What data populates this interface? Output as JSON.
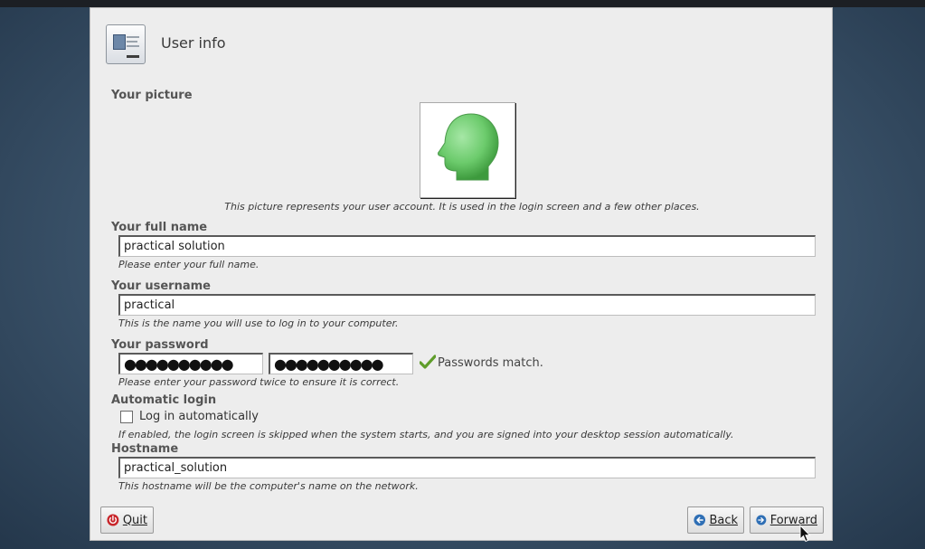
{
  "window": {
    "title": "User info",
    "icon": "user-card-icon"
  },
  "picture": {
    "label": "Your picture",
    "icon": "head-avatar-icon",
    "description": "This picture represents your user account. It is used in the login screen and a few other places."
  },
  "full_name": {
    "label": "Your full name",
    "value": "practical solution",
    "help": "Please enter your full name."
  },
  "username": {
    "label": "Your username",
    "value": "practical",
    "help": "This is the name you will use to log in to your computer."
  },
  "password": {
    "label": "Your password",
    "value_masked": "●●●●●●●●●●",
    "confirm_masked": "●●●●●●●●●●",
    "status": "Passwords match.",
    "status_icon": "checkmark-icon",
    "help": "Please enter your password twice to ensure it is correct."
  },
  "auto_login": {
    "label": "Automatic login",
    "checkbox_label": "Log in automatically",
    "checked": false,
    "help": "If enabled, the login screen is skipped when the system starts, and you are signed into your desktop session automatically."
  },
  "hostname": {
    "label": "Hostname",
    "value": "practical_solution",
    "help": "This hostname will be the computer's name on the network."
  },
  "buttons": {
    "quit": "Quit",
    "back": "Back",
    "forward": "Forward"
  },
  "colors": {
    "quit_icon": "#c8262b",
    "nav_icon": "#2f6fb5",
    "check": "#5f9d2a",
    "avatar": "#6ccb6c"
  }
}
